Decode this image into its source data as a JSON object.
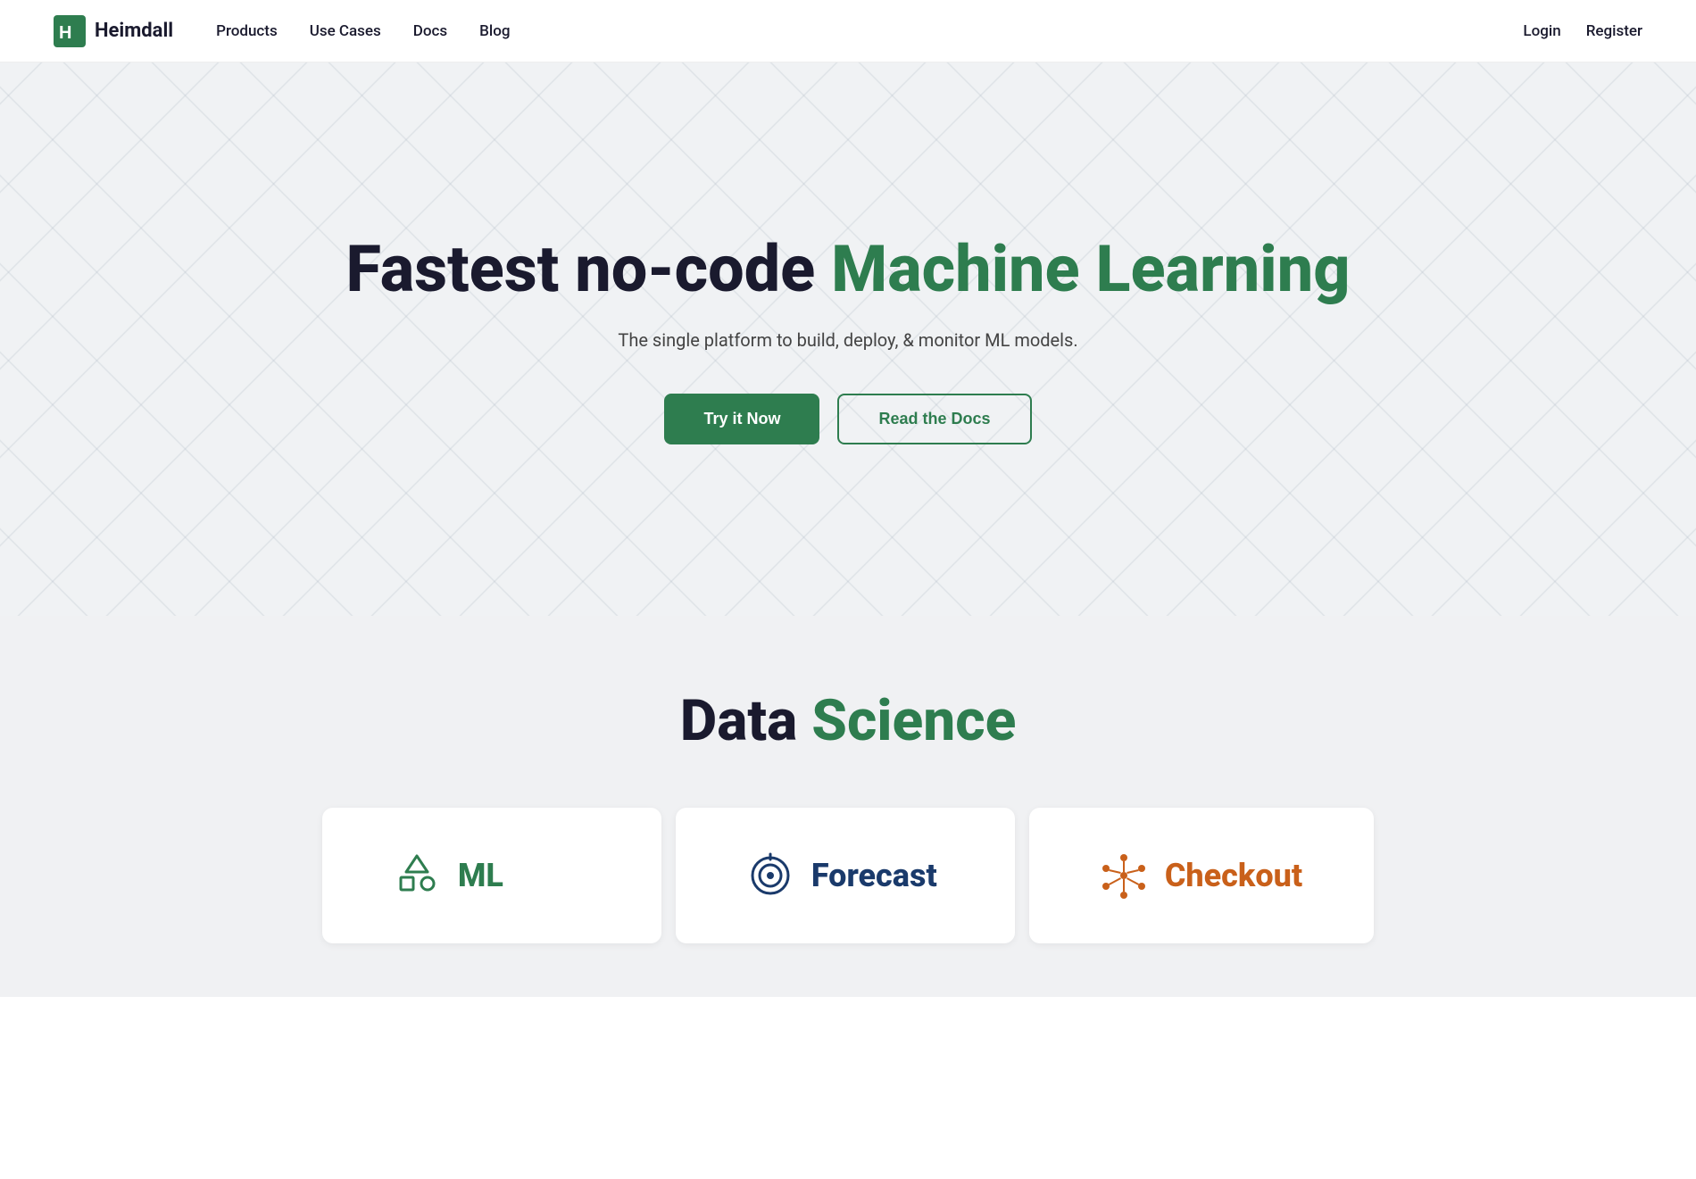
{
  "nav": {
    "logo_text": "Heimdall",
    "links": [
      {
        "label": "Products",
        "href": "#"
      },
      {
        "label": "Use Cases",
        "href": "#"
      },
      {
        "label": "Docs",
        "href": "#"
      },
      {
        "label": "Blog",
        "href": "#"
      }
    ],
    "auth": [
      {
        "label": "Login",
        "href": "#"
      },
      {
        "label": "Register",
        "href": "#"
      }
    ]
  },
  "hero": {
    "title_part1": "Fastest no-code ",
    "title_part2": "Machine Learning",
    "subtitle": "The single platform to build, deploy, & monitor ML models.",
    "cta_primary": "Try it Now",
    "cta_secondary": "Read the Docs"
  },
  "ds_section": {
    "title_part1": "Data ",
    "title_part2": "Science",
    "cards": [
      {
        "id": "ml",
        "label": "ML",
        "color": "green"
      },
      {
        "id": "forecast",
        "label": "Forecast",
        "color": "blue"
      },
      {
        "id": "checkout",
        "label": "Checkout",
        "color": "orange"
      }
    ]
  },
  "colors": {
    "green": "#2e7d4f",
    "dark": "#1a1a2e",
    "blue": "#1a3a6b",
    "orange": "#c9601a"
  }
}
